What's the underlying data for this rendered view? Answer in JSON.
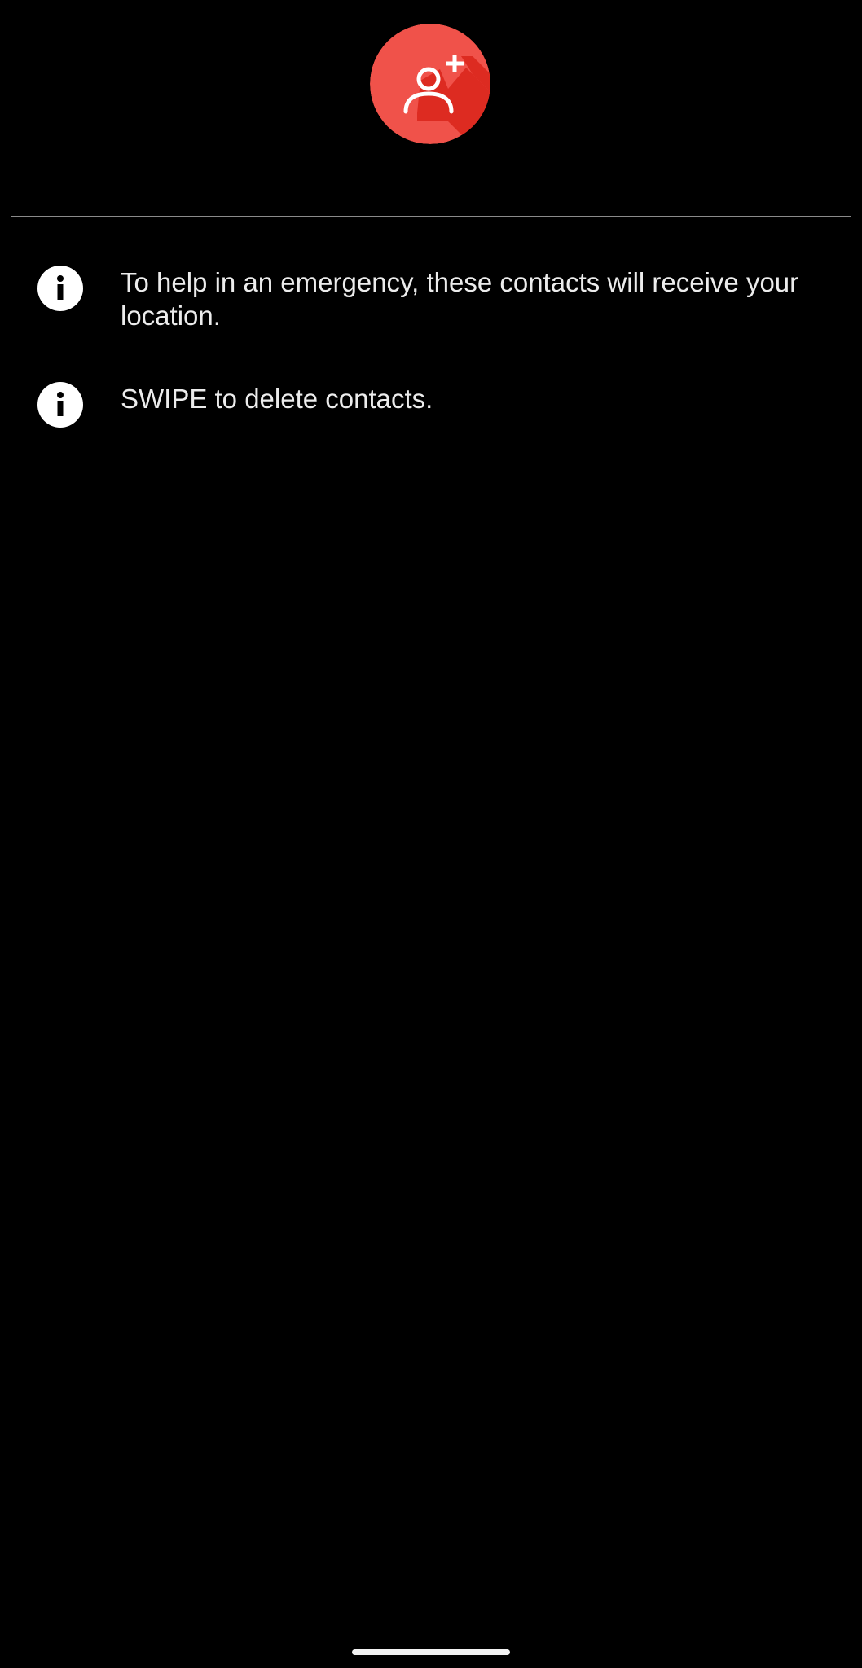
{
  "header": {
    "add_contact_icon": "person-add-icon",
    "accent_color": "#f0524a"
  },
  "info": {
    "items": [
      {
        "icon": "info-icon",
        "text": "To help in an emergency, these contacts will receive your location."
      },
      {
        "icon": "info-icon",
        "text": "SWIPE to delete contacts."
      }
    ]
  }
}
